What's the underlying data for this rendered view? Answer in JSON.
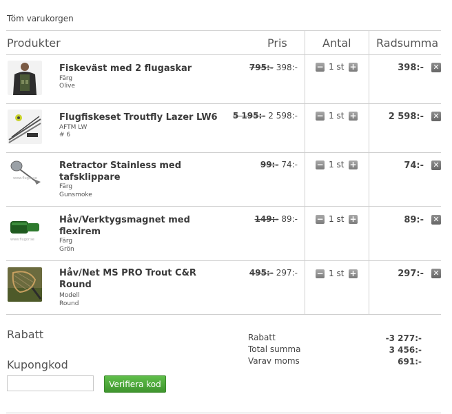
{
  "cart": {
    "empty_label": "Töm varukorgen",
    "headers": {
      "product": "Produkter",
      "price": "Pris",
      "quantity": "Antal",
      "row_sum": "Radsumma"
    },
    "items": [
      {
        "name": "Fiskeväst med 2 flugaskar",
        "attr1": "Färg",
        "attr2": "Olive",
        "old_price": "795:-",
        "price": "398:-",
        "qty": "1 st",
        "row_sum": "398:-"
      },
      {
        "name": "Flugfiskeset Troutfly Lazer LW6",
        "attr1": "AFTM LW",
        "attr2": "# 6",
        "old_price": "5 195:-",
        "price": "2 598:-",
        "qty": "1 st",
        "row_sum": "2 598:-"
      },
      {
        "name": "Retractor Stainless med tafsklippare",
        "attr1": "Färg",
        "attr2": "Gunsmoke",
        "old_price": "99:-",
        "price": "74:-",
        "qty": "1 st",
        "row_sum": "74:-"
      },
      {
        "name": "Håv/Verktygsmagnet med flexirem",
        "attr1": "Färg",
        "attr2": "Grön",
        "old_price": "149:-",
        "price": "89:-",
        "qty": "1 st",
        "row_sum": "89:-"
      },
      {
        "name": "Håv/Net MS PRO Trout C&R Round",
        "attr1": "Modell",
        "attr2": "Round",
        "old_price": "495:-",
        "price": "297:-",
        "qty": "1 st",
        "row_sum": "297:-"
      }
    ],
    "qty_minus_symbol": "−",
    "qty_plus_symbol": "+",
    "remove_symbol": "✕"
  },
  "discount": {
    "title": "Rabatt",
    "coupon_title": "Kupongkod",
    "coupon_value": "",
    "verify_label": "Verifiera kod"
  },
  "totals": {
    "discount_label": "Rabatt",
    "discount_value": "-3 277:-",
    "total_label": "Total summa",
    "total_value": "3 456:-",
    "vat_label": "Varav moms",
    "vat_value": "691:-"
  },
  "colors": {
    "accent_button": "#4aa838",
    "border": "#cfcfcf"
  }
}
